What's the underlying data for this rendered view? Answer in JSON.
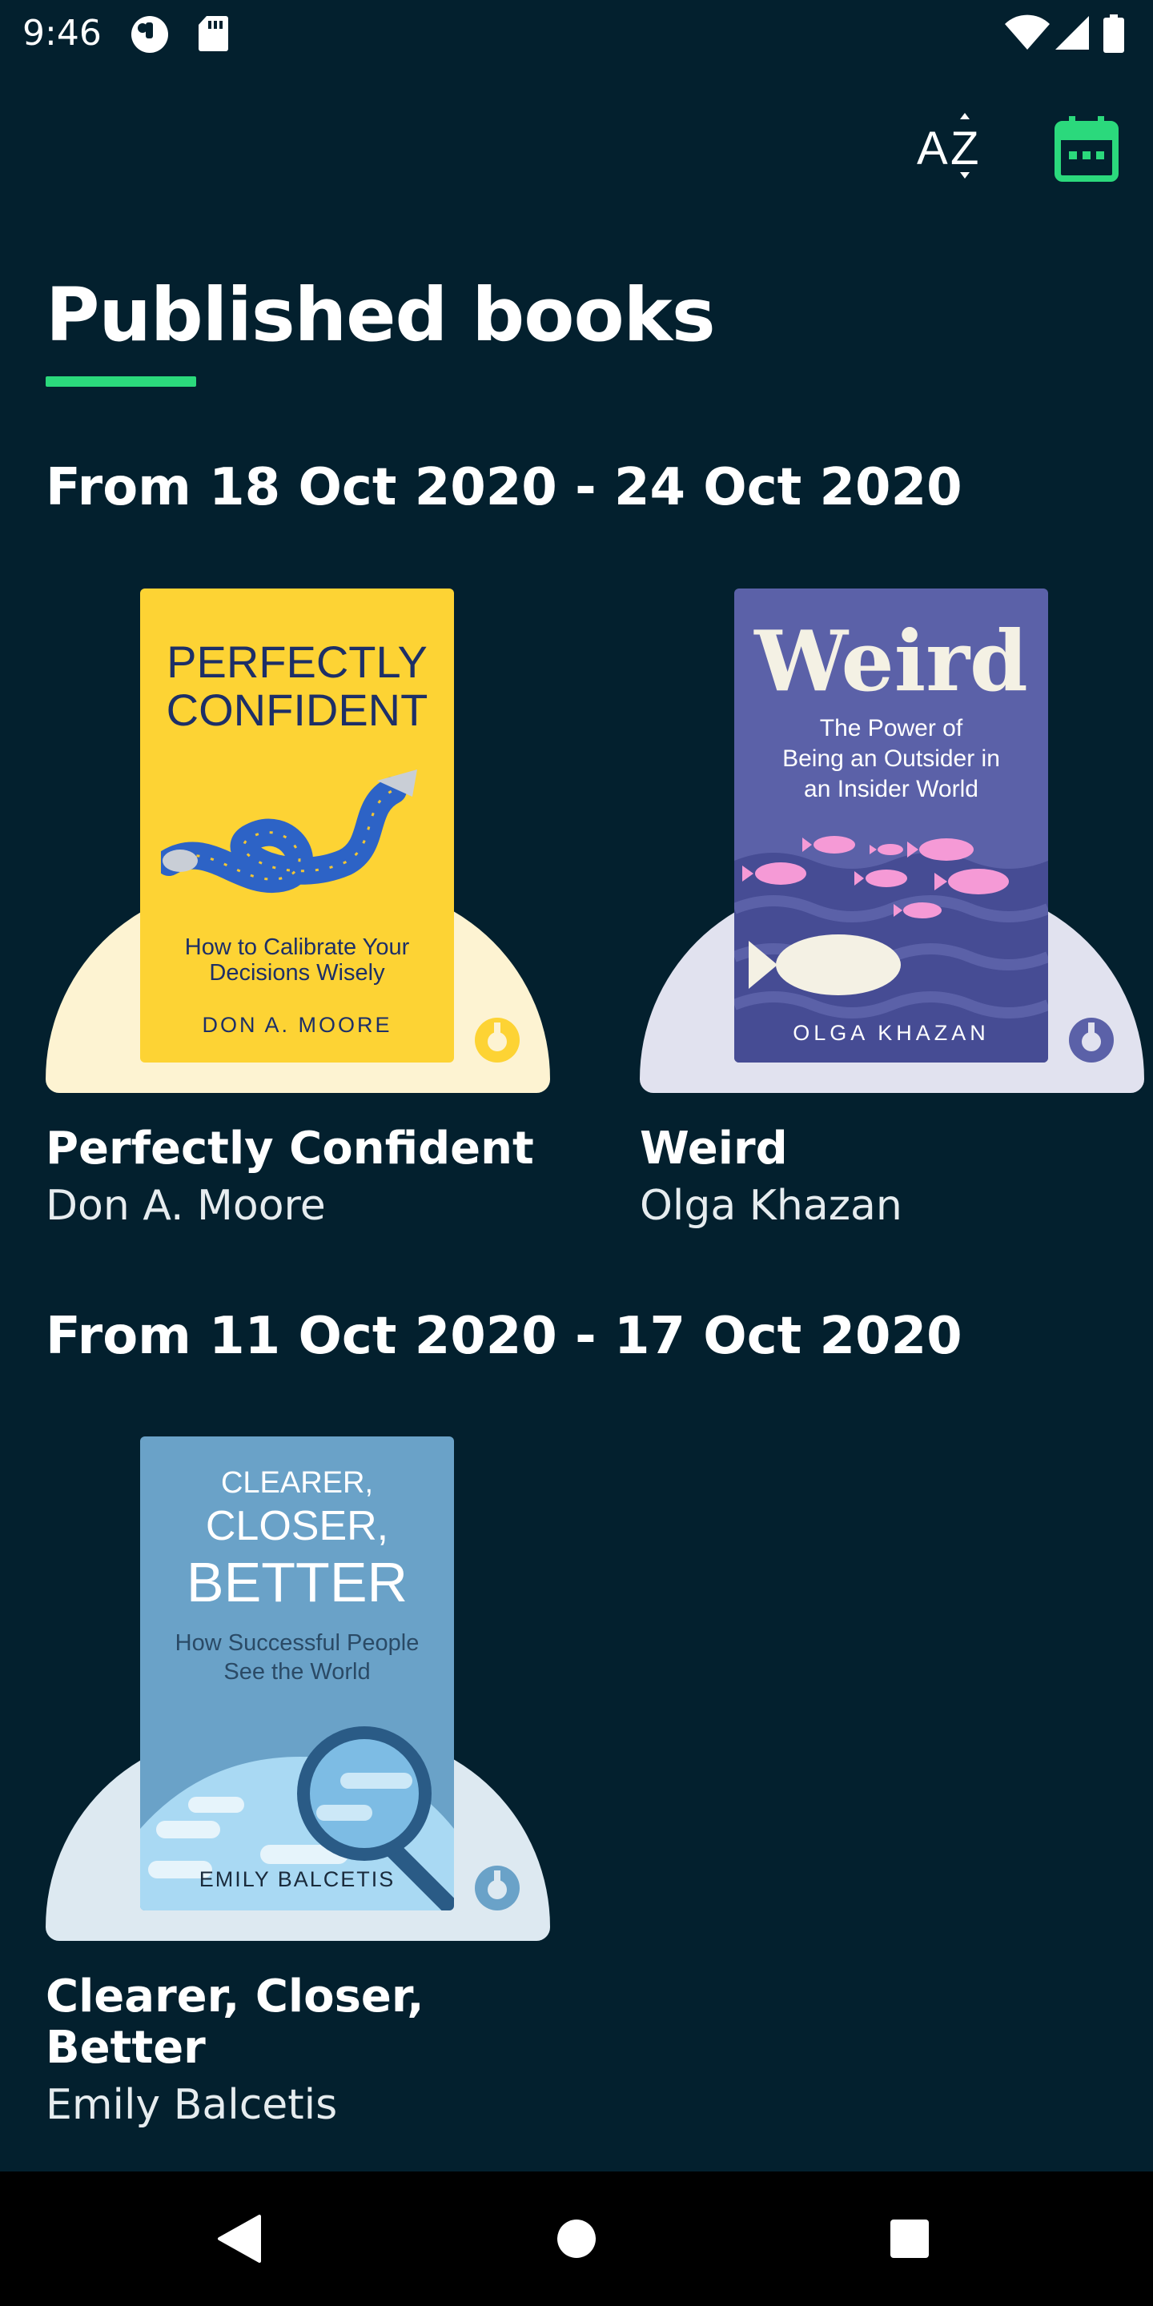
{
  "status_bar": {
    "time": "9:46",
    "icons": [
      "notification-icon",
      "sd-card-icon",
      "wifi-icon",
      "signal-icon",
      "battery-icon"
    ]
  },
  "toolbar": {
    "sort_icon": "sort-az-icon",
    "calendar_icon": "calendar-icon",
    "sort_label": "AZ"
  },
  "page": {
    "title": "Published books",
    "accent": "#2bd97c",
    "background": "#03202e"
  },
  "sections": [
    {
      "heading": "From 18 Oct 2020 - 24 Oct 2020",
      "books": [
        {
          "title": "Perfectly Confident",
          "author": "Don A. Moore",
          "cover": {
            "line1": "PERFECTLY",
            "line2": "CONFIDENT",
            "subtitle1": "How to Calibrate Your",
            "subtitle2": "Decisions Wisely",
            "author": "DON A. MOORE",
            "bg": "#fdd334",
            "stage": "#fdf3d2"
          }
        },
        {
          "title": "Weird",
          "author": "Olga Khazan",
          "cover": {
            "line1": "Weird",
            "subtitle1": "The Power of",
            "subtitle2": "Being an Outsider in",
            "subtitle3": "an Insider World",
            "author": "OLGA KHAZAN",
            "bg": "#5b61a8",
            "stage": "#e1e2ef"
          }
        }
      ]
    },
    {
      "heading": "From 11 Oct 2020 - 17 Oct 2020",
      "books": [
        {
          "title": "Clearer, Closer, Better",
          "author": "Emily Balcetis",
          "cover": {
            "line1": "CLEARER,",
            "line2": "CLOSER,",
            "line3": "BETTER",
            "subtitle1": "How Successful People",
            "subtitle2": "See the World",
            "author": "EMILY BALCETIS",
            "bg": "#6aa2c8",
            "stage": "#dde9f1"
          }
        }
      ]
    }
  ],
  "nav_bar": {
    "back_icon": "back-icon",
    "home_icon": "home-icon",
    "recents_icon": "recents-icon"
  }
}
